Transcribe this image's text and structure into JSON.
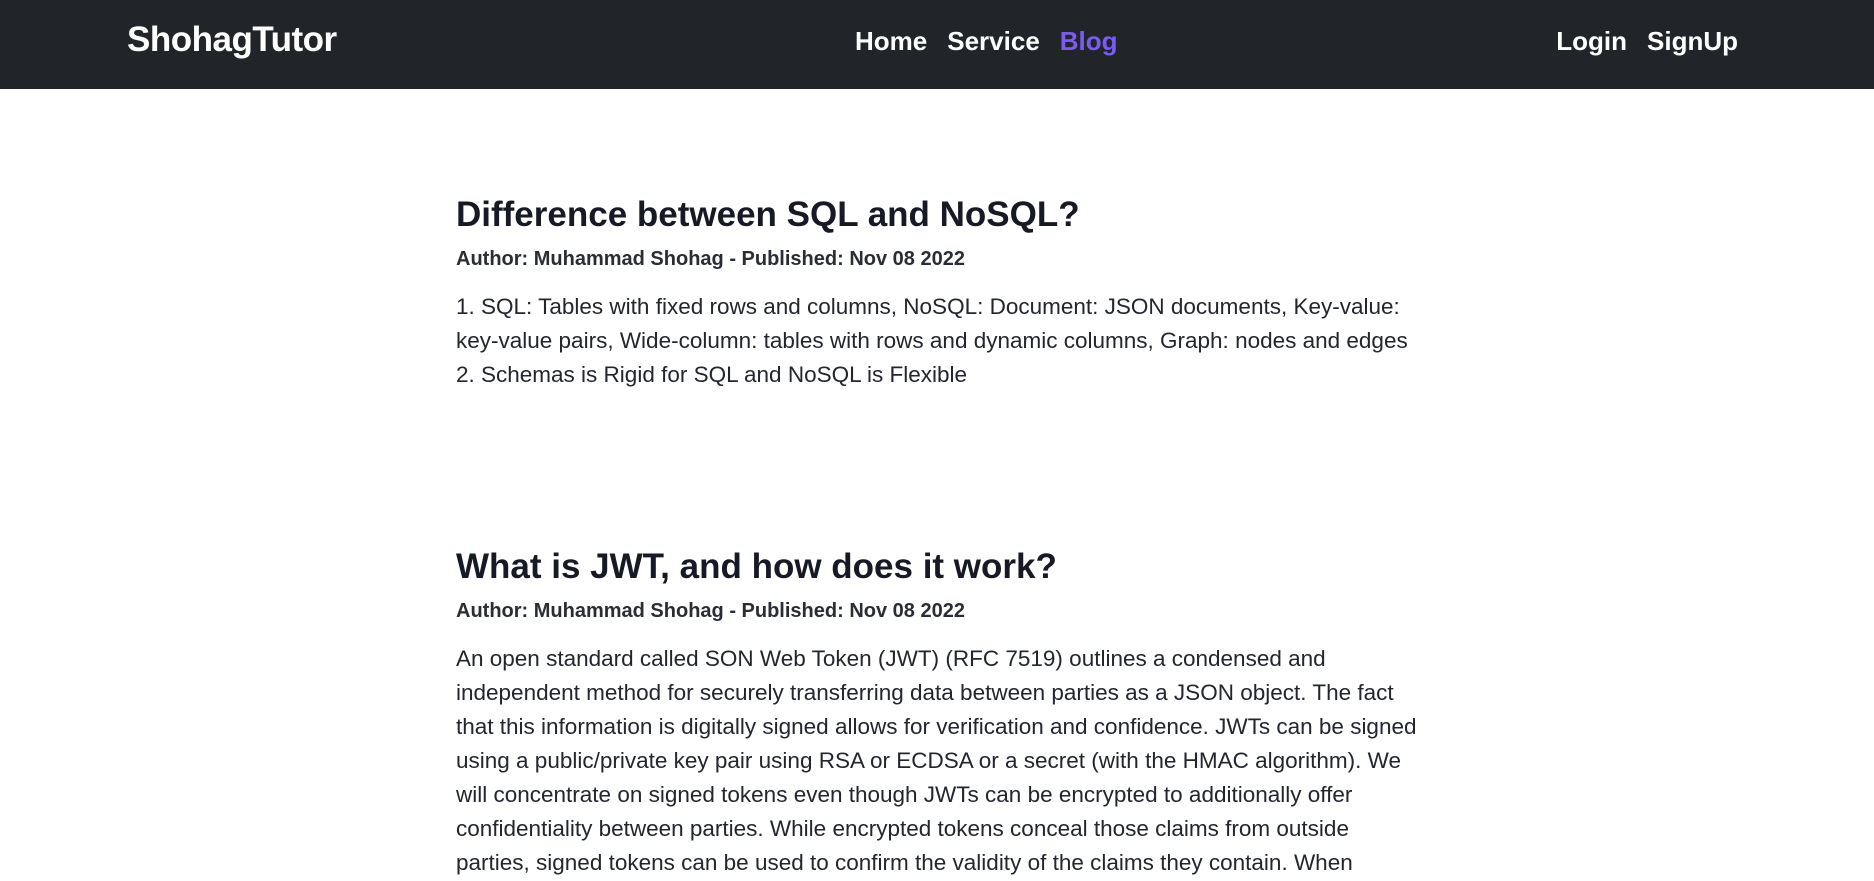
{
  "navbar": {
    "brand": "ShohagTutor",
    "links": [
      {
        "label": "Home"
      },
      {
        "label": "Service"
      },
      {
        "label": "Blog"
      }
    ],
    "auth": [
      {
        "label": "Login"
      },
      {
        "label": "SignUp"
      }
    ],
    "active_color": "#7b5cf0",
    "background": "#212529"
  },
  "posts": [
    {
      "title": "Difference between SQL and NoSQL?",
      "meta": "Author: Muhammad Shohag - Published: Nov 08 2022",
      "body": "1. SQL: Tables with fixed rows and columns, NoSQL: Document: JSON documents, Key-value: key-value pairs, Wide-column: tables with rows and dynamic columns, Graph: nodes and edges 2. Schemas is Rigid for SQL and NoSQL is Flexible"
    },
    {
      "title": "What is JWT, and how does it work?",
      "meta": "Author: Muhammad Shohag - Published: Nov 08 2022",
      "body": "An open standard called SON Web Token (JWT) (RFC 7519) outlines a condensed and independent method for securely transferring data between parties as a JSON object. The fact that this information is digitally signed allows for verification and confidence. JWTs can be signed using a public/private key pair using RSA or ECDSA or a secret (with the HMAC algorithm). We will concentrate on signed tokens even though JWTs can be encrypted to additionally offer confidentiality between parties. While encrypted tokens conceal those claims from outside parties, signed tokens can be used to confirm the validity of the claims they contain. When"
    }
  ]
}
